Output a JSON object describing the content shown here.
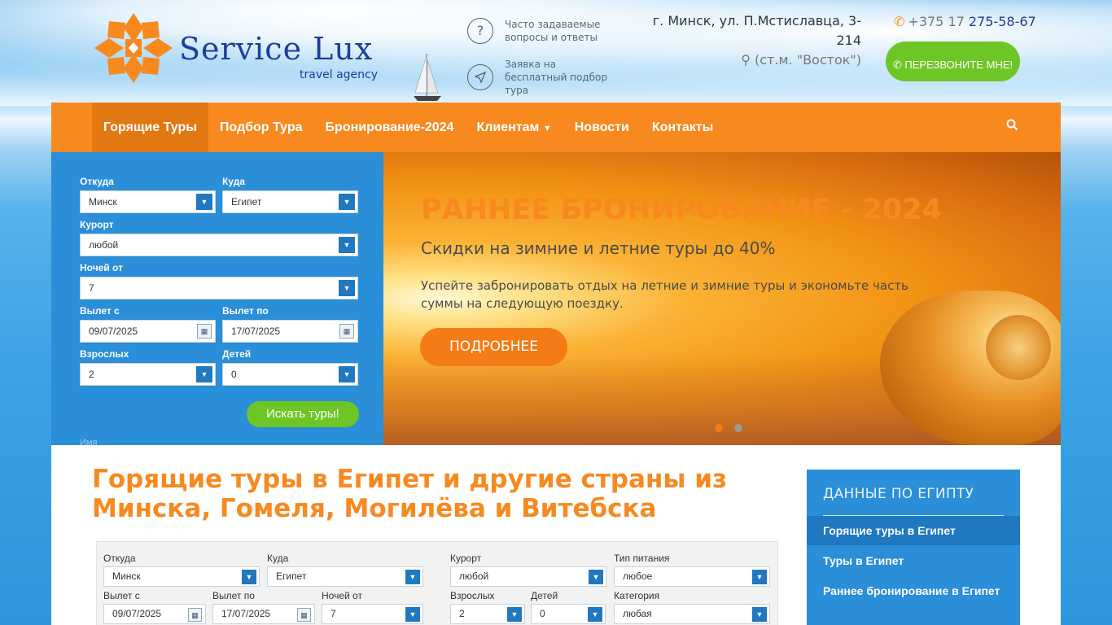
{
  "brand": {
    "name": "Service Lux",
    "tagline": "travel agency"
  },
  "header": {
    "faq": "Часто задаваемые вопросы и ответы",
    "request": "Заявка на бесплатный подбор тура",
    "address": "г. Минск, ул. П.Мстиславца, 3-214",
    "metro": "(ст.м. \"Восток\")",
    "phone_prefix": "+375 17",
    "phone_number": "275-58-67",
    "callback_button": "ПЕРЕЗВОНИТЕ МНЕ!"
  },
  "nav": {
    "items": [
      "Горящие Туры",
      "Подбор Тура",
      "Бронирование-2024",
      "Клиентам",
      "Новости",
      "Контакты"
    ],
    "active_index": 0
  },
  "search_form": {
    "from_label": "Откуда",
    "from_value": "Минск",
    "to_label": "Куда",
    "to_value": "Египет",
    "resort_label": "Курорт",
    "resort_value": "любой",
    "nights_label": "Ночей от",
    "nights_value": "7",
    "depart_from_label": "Вылет с",
    "depart_from_value": "09/07/2025",
    "depart_to_label": "Вылет по",
    "depart_to_value": "17/07/2025",
    "adults_label": "Взрослых",
    "adults_value": "2",
    "children_label": "Детей",
    "children_value": "0",
    "submit": "Искать туры!",
    "name_label": "Имя"
  },
  "banner": {
    "title": "РАННЕЕ БРОНИРОВАНИЕ - 2024",
    "subtitle": "Скидки на зимние и летние туры до 40%",
    "text": "Успейте забронировать отдых на летние и зимние туры и экономьте часть суммы на следующую поездку.",
    "button": "ПОДРОБНЕЕ",
    "slides": 2,
    "active_slide": 0
  },
  "main": {
    "heading": "Горящие туры в Египет и другие страны из Минска, Гомеля, Могилёва и Витебска"
  },
  "form2": {
    "from_label": "Откуда",
    "from_value": "Минск",
    "to_label": "Куда",
    "to_value": "Египет",
    "resort_label": "Курорт",
    "resort_value": "любой",
    "meal_label": "Тип питания",
    "meal_value": "любое",
    "depart_from_label": "Вылет с",
    "depart_from_value": "09/07/2025",
    "depart_to_label": "Вылет по",
    "depart_to_value": "17/07/2025",
    "nights_label": "Ночей от",
    "nights_value": "7",
    "adults_label": "Взрослых",
    "adults_value": "2",
    "children_label": "Детей",
    "children_value": "0",
    "category_label": "Категория",
    "category_value": "любая"
  },
  "sidebar": {
    "heading": "ДАННЫЕ ПО ЕГИПТУ",
    "items": [
      "Горящие туры в Египет",
      "Туры в Египет",
      "Раннее бронирование в Египет"
    ]
  },
  "colors": {
    "orange": "#f7891f",
    "blue": "#2a8ed8",
    "green": "#6ec626",
    "navy": "#1b3f9a"
  }
}
